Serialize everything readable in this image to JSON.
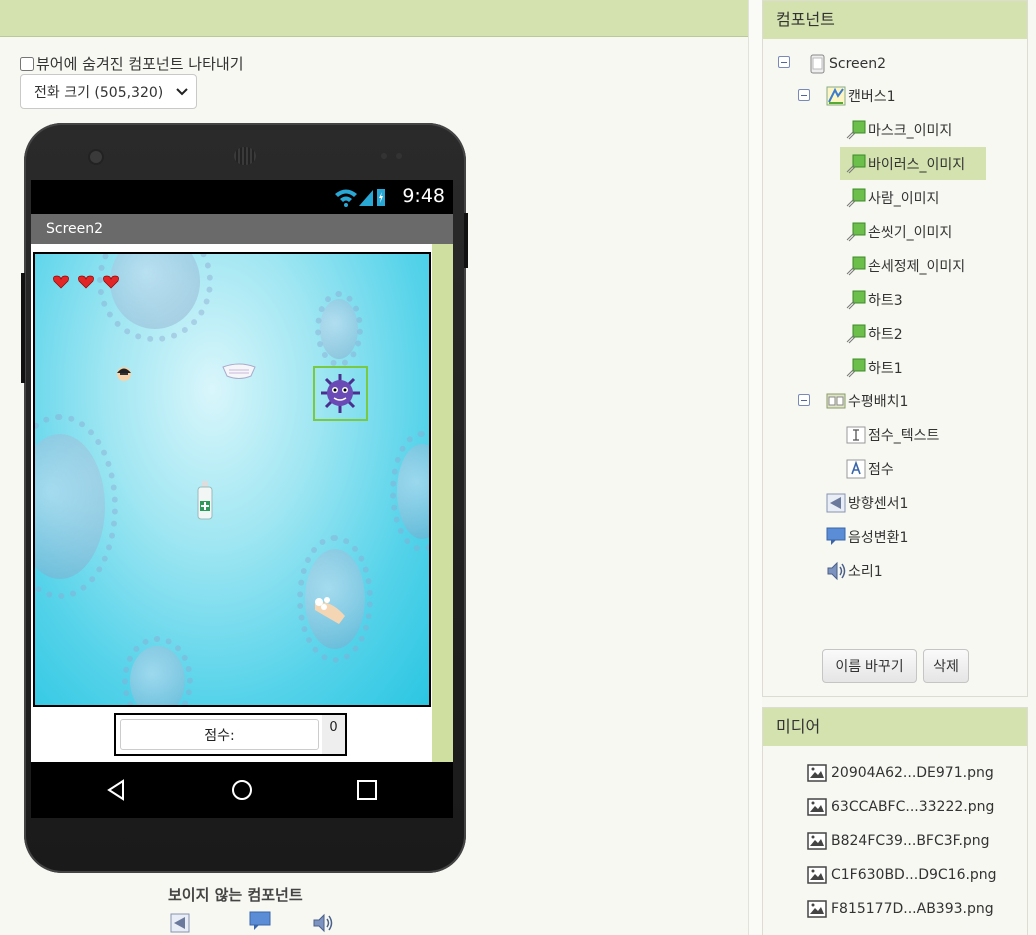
{
  "viewer": {
    "hidden_toggle_label": "뷰어에 숨겨진 컴포넌트 나타내기",
    "size_select_value": "전화 크기 (505,320)",
    "phone": {
      "status_time": "9:48",
      "screen_title": "Screen2",
      "score_label": "점수:",
      "score_value": "0"
    },
    "nonvisible_title": "보이지 않는 컴포넌트",
    "nonvisible_icons": [
      "orientation-sensor-icon",
      "text-to-speech-icon",
      "sound-icon"
    ]
  },
  "components": {
    "header": "컴포넌트",
    "tree": [
      {
        "label": "Screen2",
        "icon": "screen-icon"
      },
      {
        "label": "캔버스1",
        "icon": "canvas-icon"
      },
      {
        "label": "마스크_이미지",
        "icon": "image-sprite-icon"
      },
      {
        "label": "바이러스_이미지",
        "icon": "image-sprite-icon",
        "selected": true
      },
      {
        "label": "사람_이미지",
        "icon": "image-sprite-icon"
      },
      {
        "label": "손씻기_이미지",
        "icon": "image-sprite-icon"
      },
      {
        "label": "손세정제_이미지",
        "icon": "image-sprite-icon"
      },
      {
        "label": "하트3",
        "icon": "image-sprite-icon"
      },
      {
        "label": "하트2",
        "icon": "image-sprite-icon"
      },
      {
        "label": "하트1",
        "icon": "image-sprite-icon"
      },
      {
        "label": "수평배치1",
        "icon": "horizontal-arrangement-icon"
      },
      {
        "label": "점수_텍스트",
        "icon": "textbox-icon"
      },
      {
        "label": "점수",
        "icon": "label-icon"
      },
      {
        "label": "방향센서1",
        "icon": "orientation-sensor-icon"
      },
      {
        "label": "음성변환1",
        "icon": "text-to-speech-icon"
      },
      {
        "label": "소리1",
        "icon": "sound-icon"
      }
    ],
    "rename_button": "이름 바꾸기",
    "delete_button": "삭제"
  },
  "media": {
    "header": "미디어",
    "files": [
      "20904A62...DE971.png",
      "63CCABFC...33222.png",
      "B824FC39...BFC3F.png",
      "C1F630BD...D9C16.png",
      "F815177D...AB393.png"
    ]
  },
  "colors": {
    "header_green": "#d3e2ae",
    "selected_green": "#d3e2ae",
    "canvas_cyan": "#56d3ea"
  }
}
